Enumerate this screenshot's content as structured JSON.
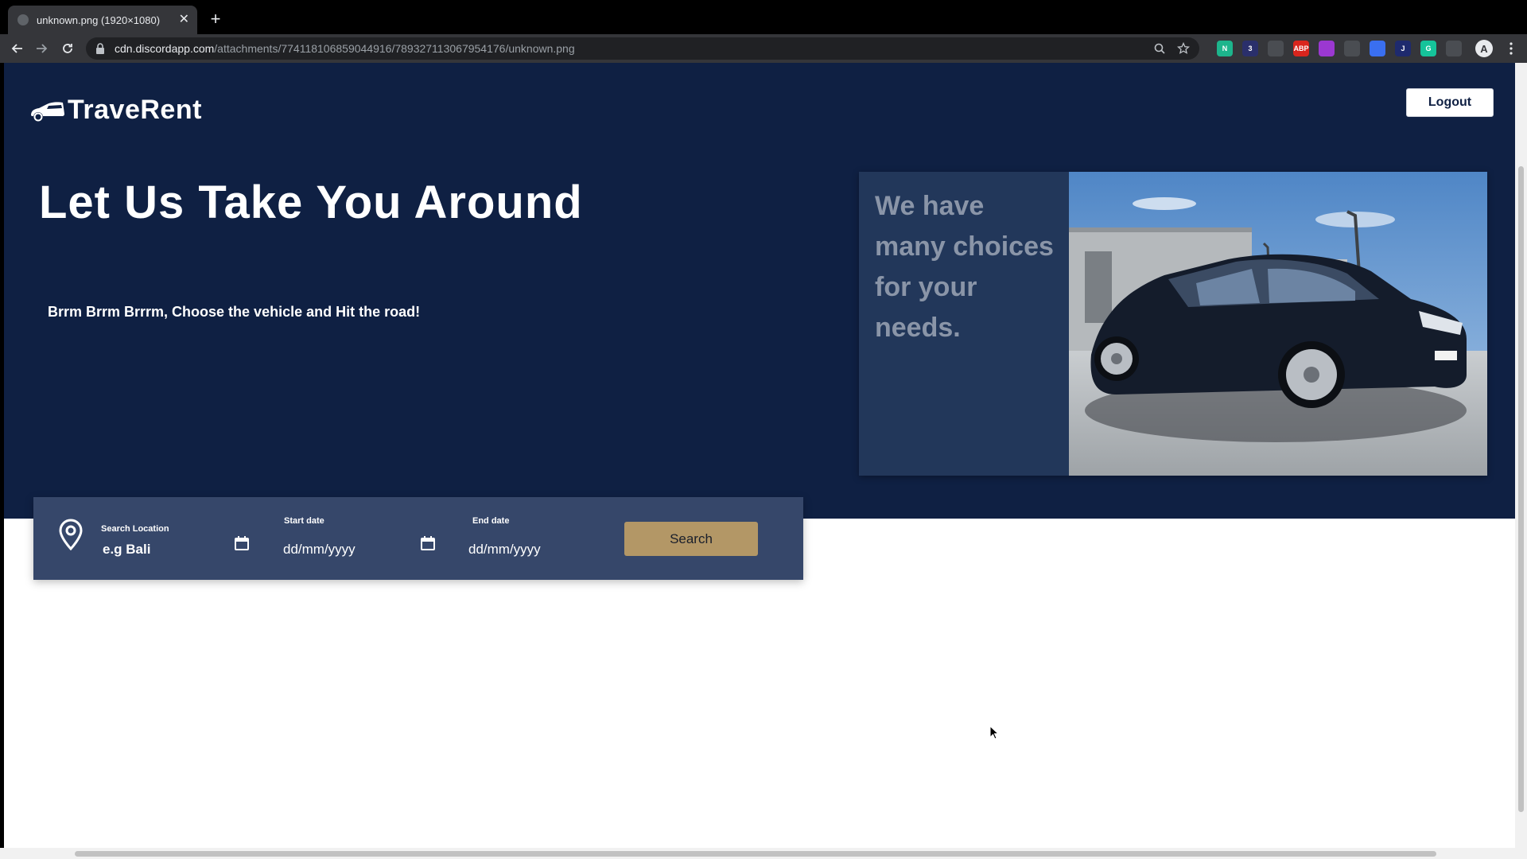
{
  "browser": {
    "tab_title": "unknown.png (1920×1080)",
    "new_tab_label": "+",
    "url_host": "cdn.discordapp.com",
    "url_path": "/attachments/774118106859044916/789327113067954176/unknown.png",
    "extensions": [
      {
        "label": "N",
        "color": "#1db58c"
      },
      {
        "label": "3",
        "color": "#2a2f6b"
      },
      {
        "label": "",
        "color": "#4a4d52"
      },
      {
        "label": "ABP",
        "color": "#d9251d"
      },
      {
        "label": "",
        "color": "#9b38d1"
      },
      {
        "label": "",
        "color": "#4a4d52"
      },
      {
        "label": "",
        "color": "#3a6ff0"
      },
      {
        "label": "J",
        "color": "#1e2a6e"
      },
      {
        "label": "G",
        "color": "#15c39a"
      },
      {
        "label": "",
        "color": "#4a4d52"
      }
    ],
    "profile_initial": "A"
  },
  "header": {
    "brand": "TraveRent",
    "logout_label": "Logout"
  },
  "hero": {
    "headline": "Let Us Take You Around",
    "tagline": "Brrm Brrm Brrrm, Choose the vehicle and Hit the road!"
  },
  "promo": {
    "text": "We have many choices for your needs."
  },
  "search": {
    "location_label": "Search Location",
    "location_placeholder": "e.g Bali",
    "start_label": "Start date",
    "start_placeholder": "dd/mm/yyyy",
    "end_label": "End date",
    "end_placeholder": "dd/mm/yyyy",
    "button_label": "Search"
  },
  "colors": {
    "hero_bg": "#0f2043",
    "search_bg": "#36476a",
    "search_button": "#b39766",
    "promo_bg": "#22375a"
  }
}
